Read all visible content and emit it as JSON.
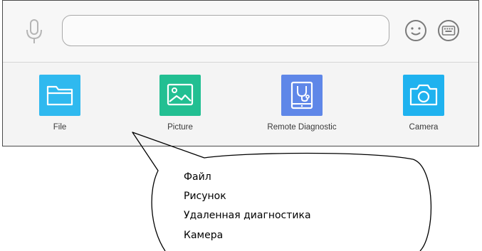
{
  "input_bar": {
    "message_value": "",
    "icons": [
      "microphone-icon",
      "emoji-icon",
      "keyboard-icon"
    ]
  },
  "attachments": [
    {
      "label": "File",
      "icon": "folder-icon",
      "color": "#2fb9ef"
    },
    {
      "label": "Picture",
      "icon": "image-icon",
      "color": "#22bf92"
    },
    {
      "label": "Remote Diagnostic",
      "icon": "stethoscope-tablet-icon",
      "color": "#5f87e8"
    },
    {
      "label": "Camera",
      "icon": "camera-icon",
      "color": "#1fb2ef"
    }
  ],
  "callout": {
    "lines": [
      "Файл",
      "Рисунок",
      "Удаленная диагностика",
      "Камера"
    ]
  }
}
